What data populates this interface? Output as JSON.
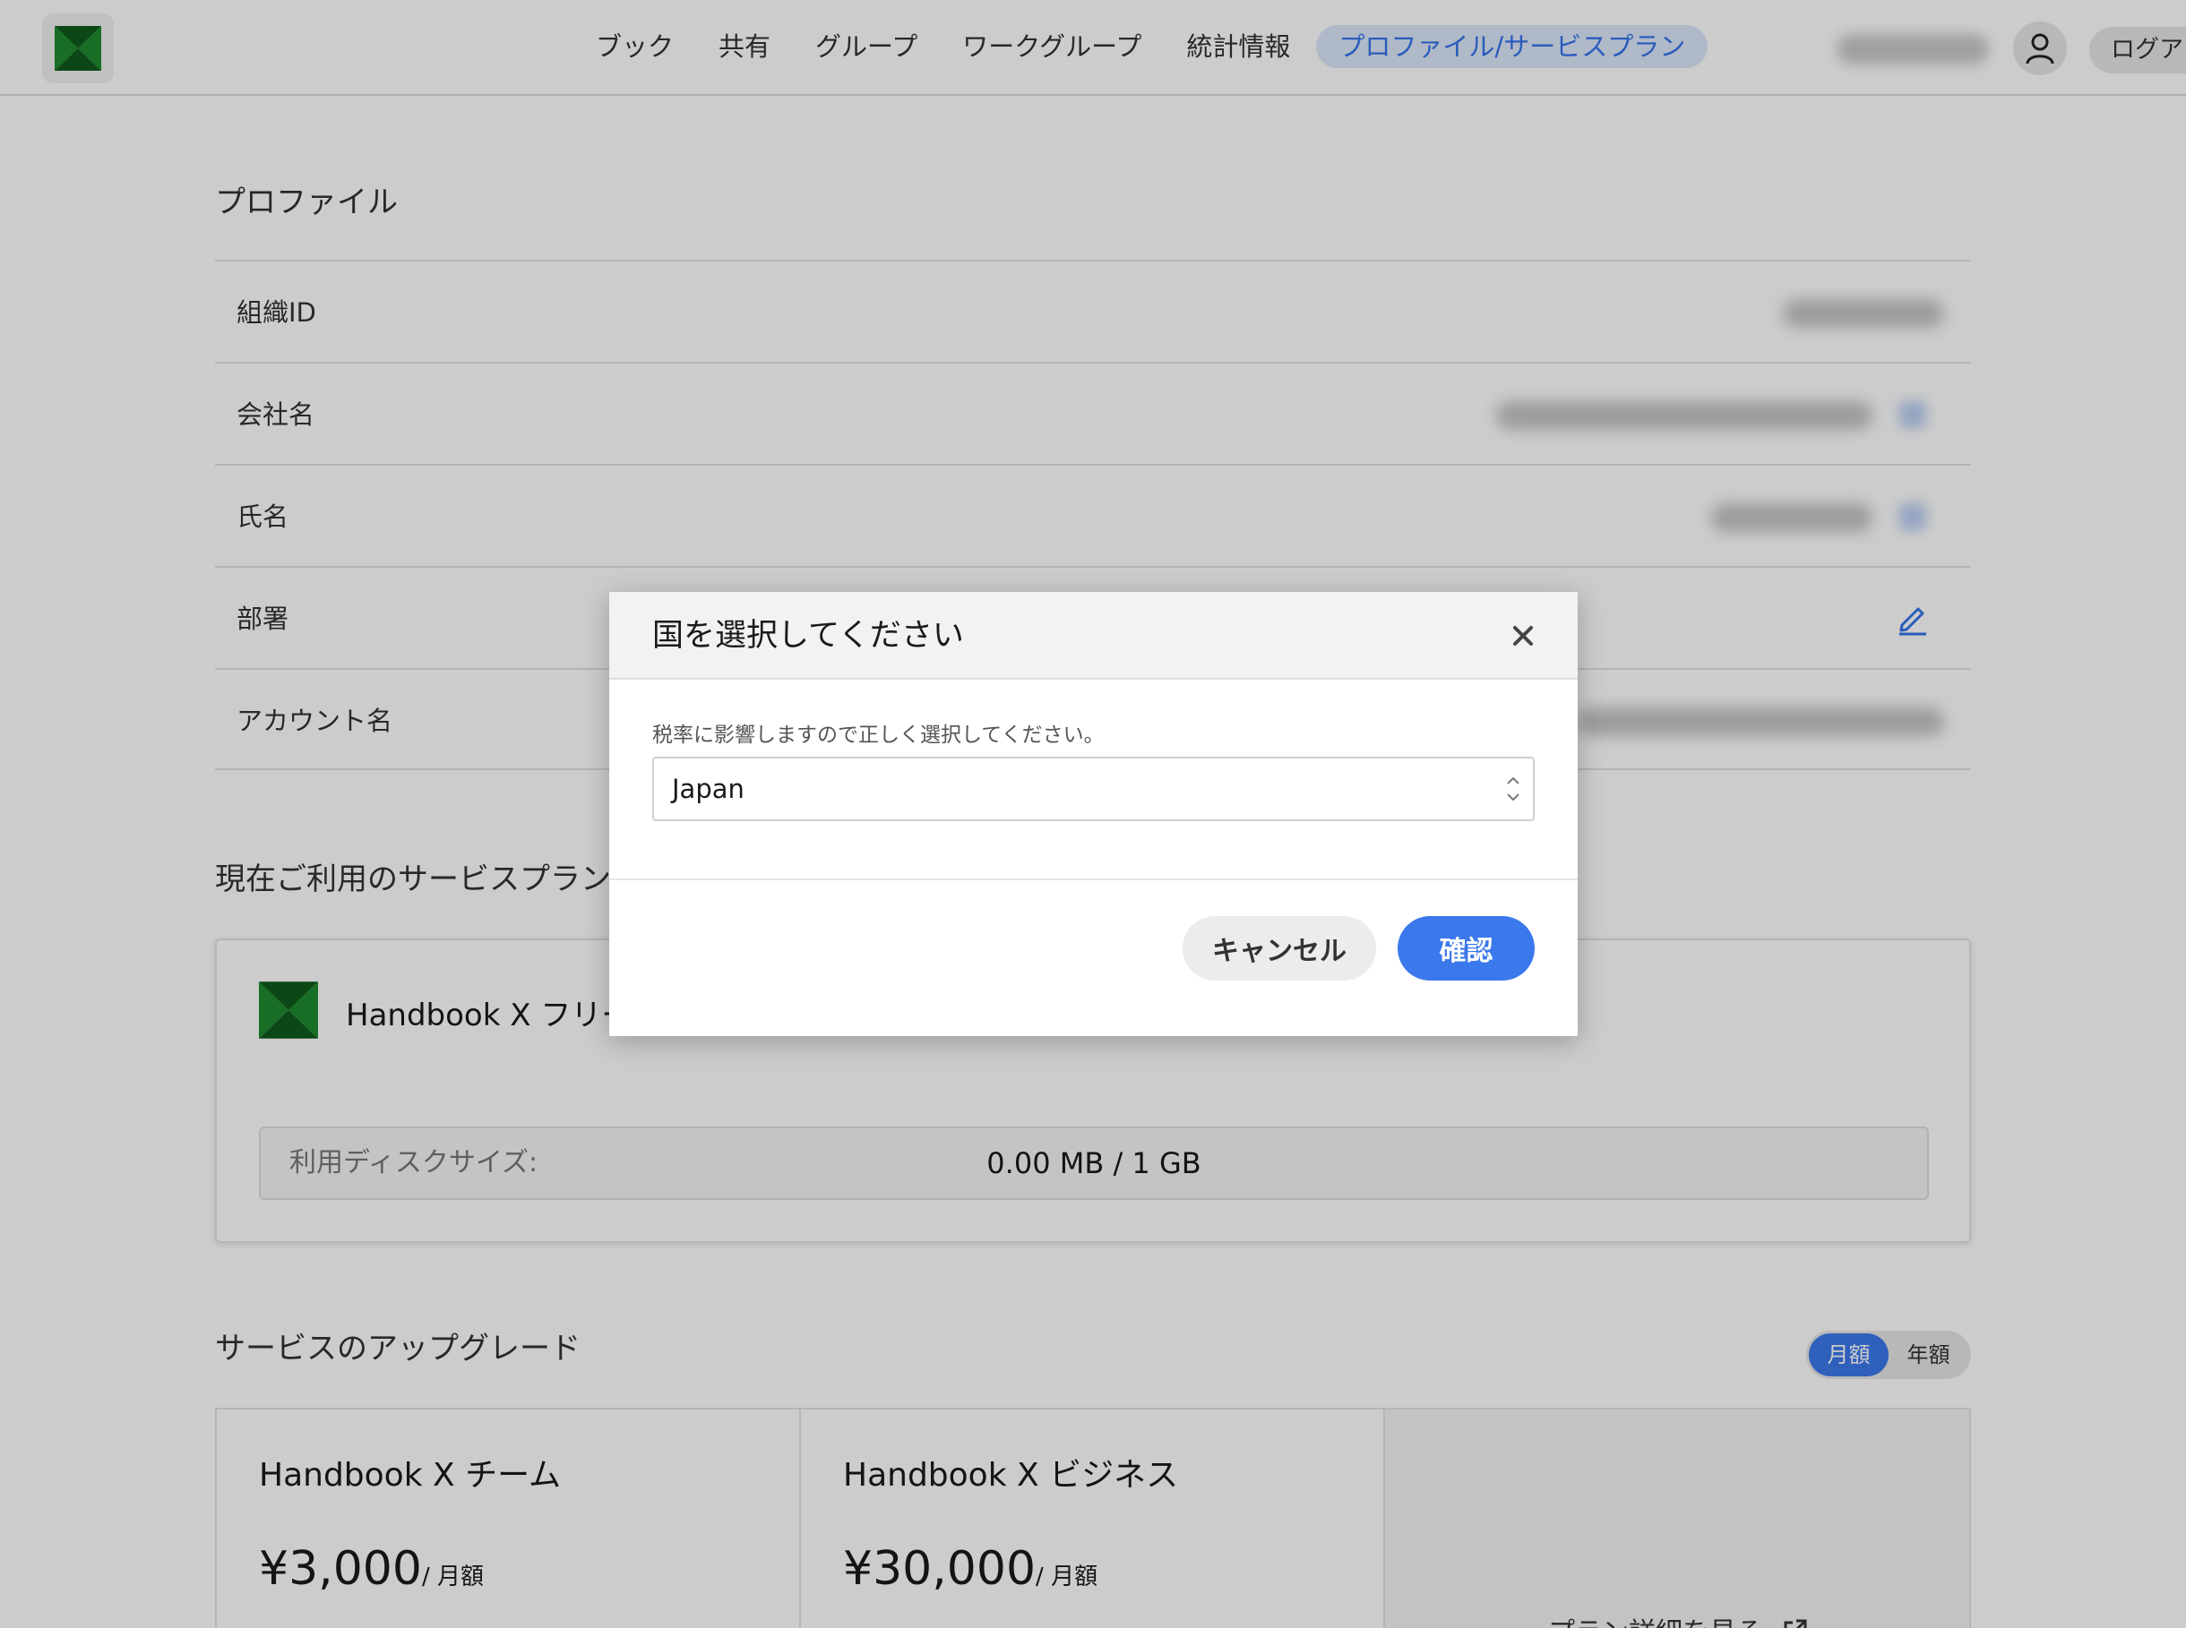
{
  "header": {
    "nav": [
      {
        "label": "ブック"
      },
      {
        "label": "共有"
      },
      {
        "label": "グループ"
      },
      {
        "label": "ワークグループ"
      },
      {
        "label": "統計情報"
      },
      {
        "label": "プロファイル/サービスプラン",
        "active": true
      }
    ],
    "logout_label": "ログアウト"
  },
  "profile": {
    "title": "プロファイル",
    "fields": [
      {
        "label": "組織ID"
      },
      {
        "label": "会社名"
      },
      {
        "label": "氏名"
      },
      {
        "label": "部署"
      },
      {
        "label": "アカウント名"
      }
    ]
  },
  "current_plan": {
    "title": "現在ご利用のサービスプラン",
    "name": "Handbook X フリー",
    "disk_label": "利用ディスクサイズ:",
    "disk_value": "0.00 MB / 1 GB"
  },
  "upgrade": {
    "title": "サービスのアップグレード",
    "billing_toggle": {
      "monthly": "月額",
      "yearly": "年額",
      "selected": "月額"
    },
    "plans": [
      {
        "name": "Handbook X チーム",
        "price": "¥3,000",
        "unit": "/ 月額"
      },
      {
        "name": "Handbook X ビジネス",
        "price": "¥30,000",
        "unit": "/ 月額"
      }
    ],
    "details_link": "プラン詳細を見る"
  },
  "modal": {
    "title": "国を選択してください",
    "hint": "税率に影響しますので正しく選択してください。",
    "country_value": "Japan",
    "cancel_label": "キャンセル",
    "confirm_label": "確認"
  },
  "colors": {
    "accent": "#3b78ec",
    "logo_green": "#1f8a2e",
    "logo_dark_green": "#0f5a1c"
  }
}
